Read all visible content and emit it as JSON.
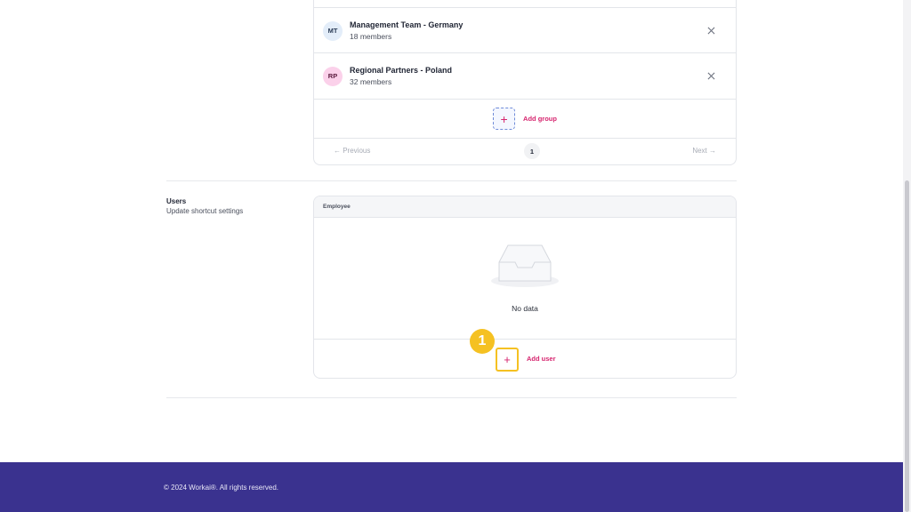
{
  "groups": {
    "items": [
      {
        "initials": "MT",
        "name": "Management Team - Germany",
        "members": "18 members",
        "remove_icon": "close-icon"
      },
      {
        "initials": "RP",
        "name": "Regional Partners - Poland",
        "members": "32 members",
        "remove_icon": "close-icon"
      }
    ],
    "add_label": "Add group",
    "add_icon": "+"
  },
  "pagination": {
    "previous": "← Previous",
    "next": "Next →",
    "current_page": "1"
  },
  "users_section": {
    "title": "Users",
    "description": "Update shortcut settings",
    "table_header": "Employee",
    "empty_text": "No data",
    "add_label": "Add user",
    "add_icon": "+",
    "step_badge": "1",
    "highlight_color": "#f5c122"
  },
  "footer": {
    "copyright": "© 2024 Workai®. All rights reserved."
  },
  "colors": {
    "accent": "#d6246e",
    "footer_bg": "#3a328f"
  }
}
